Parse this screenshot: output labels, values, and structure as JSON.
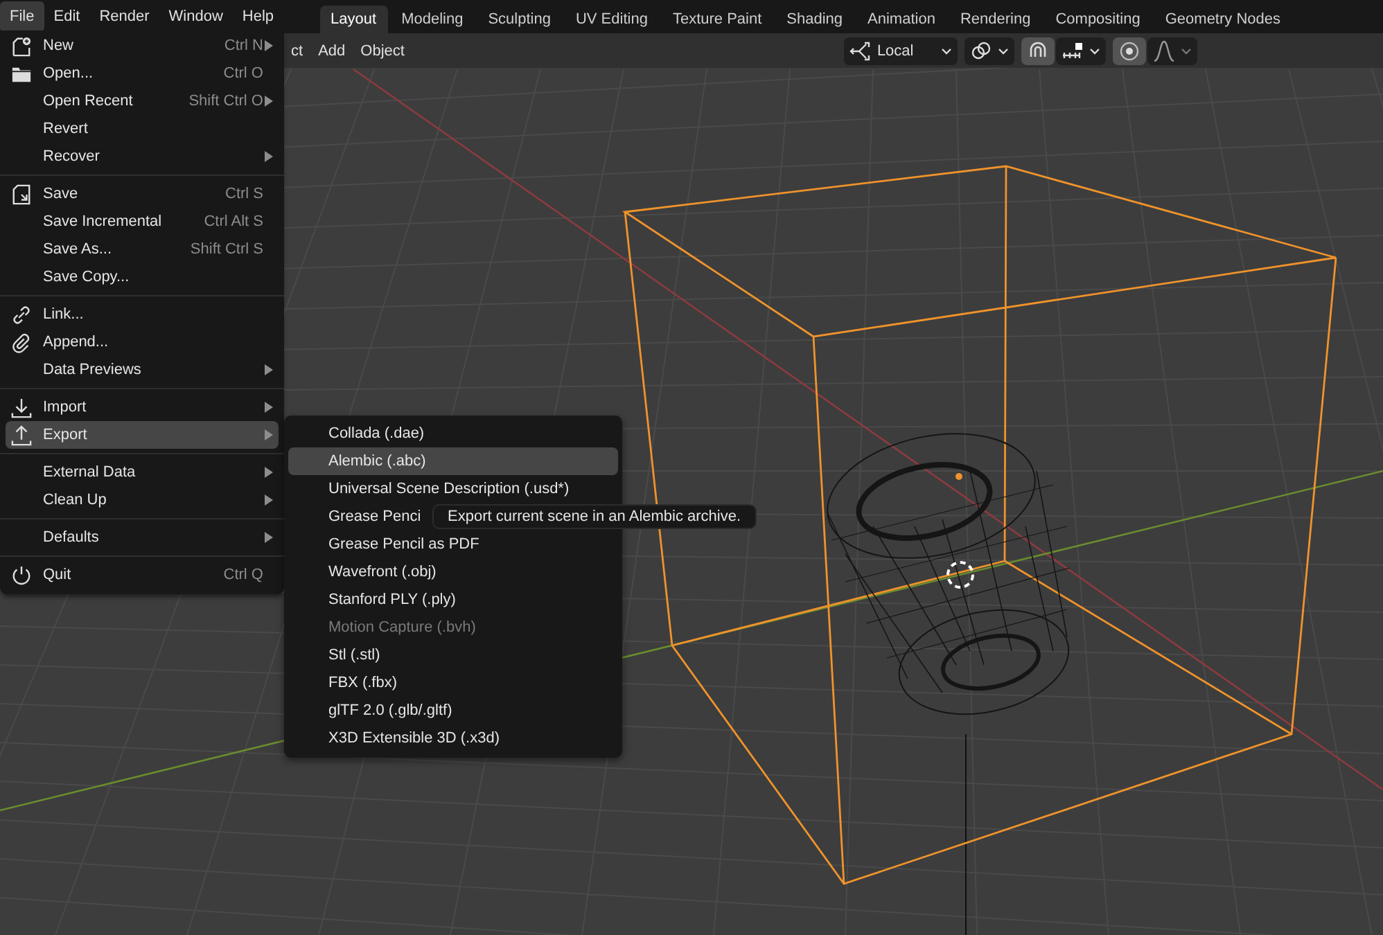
{
  "menubar": [
    {
      "label": "File",
      "selected": true
    },
    {
      "label": "Edit",
      "selected": false
    },
    {
      "label": "Render",
      "selected": false
    },
    {
      "label": "Window",
      "selected": false
    },
    {
      "label": "Help",
      "selected": false
    }
  ],
  "workspaces": [
    {
      "label": "Layout",
      "selected": true
    },
    {
      "label": "Modeling",
      "selected": false
    },
    {
      "label": "Sculpting",
      "selected": false
    },
    {
      "label": "UV Editing",
      "selected": false
    },
    {
      "label": "Texture Paint",
      "selected": false
    },
    {
      "label": "Shading",
      "selected": false
    },
    {
      "label": "Animation",
      "selected": false
    },
    {
      "label": "Rendering",
      "selected": false
    },
    {
      "label": "Compositing",
      "selected": false
    },
    {
      "label": "Geometry Nodes",
      "selected": false
    }
  ],
  "header": {
    "menus": [
      "ct",
      "Add",
      "Object"
    ],
    "pivot": {
      "label": "Local"
    },
    "snap": {
      "on": true
    },
    "proportional": {
      "on": true
    }
  },
  "file_menu": {
    "sections": [
      {
        "items": [
          {
            "label": "New",
            "shortcut": "Ctrl N",
            "kind": "new",
            "submenu": true,
            "selected": false
          },
          {
            "label": "Open...",
            "shortcut": "Ctrl O",
            "kind": "open",
            "submenu": false,
            "selected": false
          },
          {
            "label": "Open Recent",
            "shortcut": "Shift Ctrl O",
            "submenu": true,
            "selected": false
          },
          {
            "label": "Revert",
            "submenu": false,
            "selected": false
          },
          {
            "label": "Recover",
            "submenu": true,
            "selected": false
          }
        ]
      },
      {
        "items": [
          {
            "label": "Save",
            "shortcut": "Ctrl S",
            "kind": "save",
            "submenu": false,
            "selected": false
          },
          {
            "label": "Save Incremental",
            "shortcut": "Ctrl Alt S",
            "submenu": false,
            "selected": false
          },
          {
            "label": "Save As...",
            "shortcut": "Shift Ctrl S",
            "submenu": false,
            "selected": false
          },
          {
            "label": "Save Copy...",
            "submenu": false,
            "selected": false
          }
        ]
      },
      {
        "items": [
          {
            "label": "Link...",
            "kind": "link",
            "submenu": false,
            "selected": false
          },
          {
            "label": "Append...",
            "kind": "append",
            "submenu": false,
            "selected": false
          },
          {
            "label": "Data Previews",
            "submenu": true,
            "selected": false
          }
        ]
      },
      {
        "items": [
          {
            "label": "Import",
            "kind": "import",
            "submenu": true,
            "selected": false
          },
          {
            "label": "Export",
            "kind": "export",
            "submenu": true,
            "selected": true
          }
        ]
      },
      {
        "items": [
          {
            "label": "External Data",
            "submenu": true,
            "selected": false
          },
          {
            "label": "Clean Up",
            "submenu": true,
            "selected": false
          }
        ]
      },
      {
        "items": [
          {
            "label": "Defaults",
            "submenu": true,
            "selected": false
          }
        ]
      },
      {
        "items": [
          {
            "label": "Quit",
            "shortcut": "Ctrl Q",
            "kind": "quit",
            "submenu": false,
            "selected": false
          }
        ]
      }
    ]
  },
  "export_menu": {
    "items": [
      {
        "label": "Collada (.dae)",
        "selected": false,
        "disabled": false
      },
      {
        "label": "Alembic (.abc)",
        "selected": true,
        "disabled": false
      },
      {
        "label": "Universal Scene Description (.usd*)",
        "selected": false,
        "disabled": false
      },
      {
        "label": "Grease Penci",
        "selected": false,
        "disabled": false
      },
      {
        "label": "Grease Pencil as PDF",
        "selected": false,
        "disabled": false
      },
      {
        "label": "Wavefront (.obj)",
        "selected": false,
        "disabled": false
      },
      {
        "label": "Stanford PLY (.ply)",
        "selected": false,
        "disabled": false
      },
      {
        "label": "Motion Capture (.bvh)",
        "selected": false,
        "disabled": true
      },
      {
        "label": "Stl (.stl)",
        "selected": false,
        "disabled": false
      },
      {
        "label": "FBX (.fbx)",
        "selected": false,
        "disabled": false
      },
      {
        "label": "glTF 2.0 (.glb/.gltf)",
        "selected": false,
        "disabled": false
      },
      {
        "label": "X3D Extensible 3D (.x3d)",
        "selected": false,
        "disabled": false
      }
    ]
  },
  "tooltip": {
    "text": "Export current scene in an Alembic archive."
  }
}
